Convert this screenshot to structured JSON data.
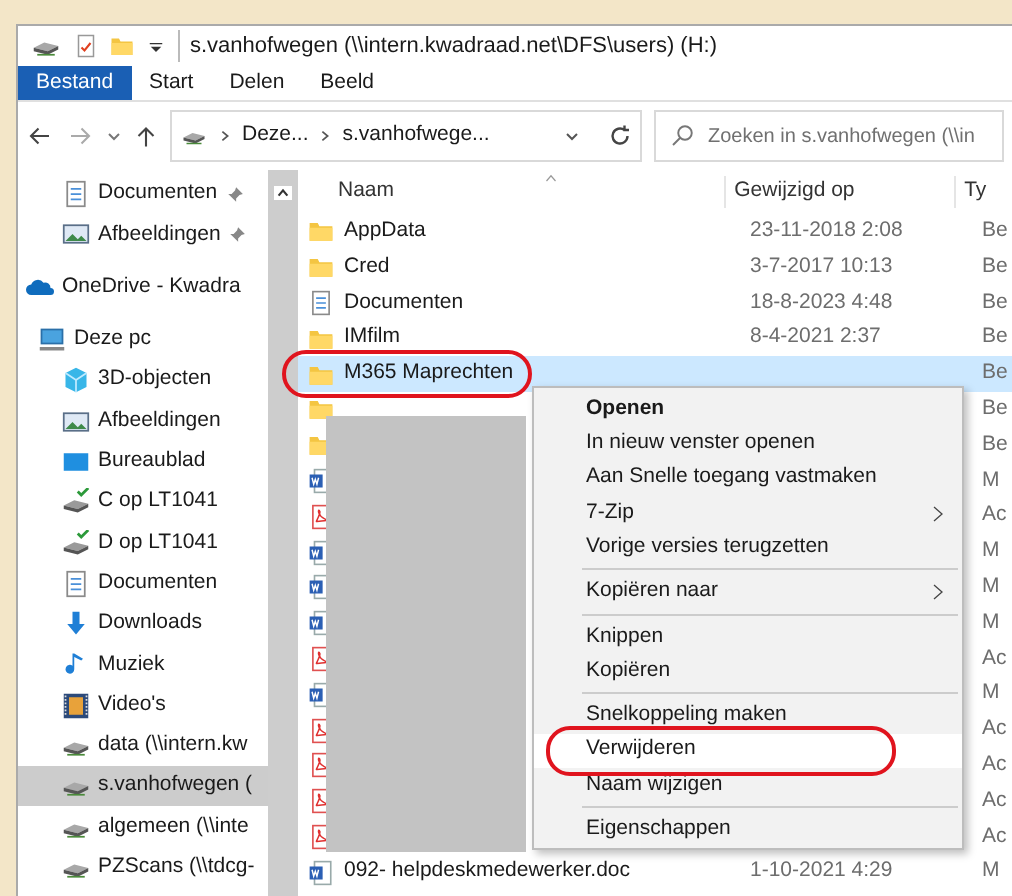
{
  "window": {
    "title": "s.vanhofwegen (\\\\intern.kwadraad.net\\DFS\\users) (H:)"
  },
  "ribbon_tabs": [
    {
      "label": "Bestand",
      "selected": true
    },
    {
      "label": "Start",
      "selected": false
    },
    {
      "label": "Delen",
      "selected": false
    },
    {
      "label": "Beeld",
      "selected": false
    }
  ],
  "address_bar": {
    "crumbs": [
      "Deze...",
      "s.vanhofwege..."
    ]
  },
  "search": {
    "placeholder": "Zoeken in s.vanhofwegen (\\\\in"
  },
  "sidebar": {
    "items": [
      {
        "label": "Documenten",
        "kind": "document",
        "pinned": true,
        "selected": false
      },
      {
        "label": "Afbeeldingen",
        "kind": "pictures",
        "pinned": true,
        "selected": false
      },
      {
        "label": "OneDrive - Kwadra",
        "kind": "cloud",
        "pinned": false,
        "selected": false
      },
      {
        "label": "Deze pc",
        "kind": "pc",
        "pinned": false,
        "selected": false,
        "children": [
          {
            "label": "3D-objecten",
            "kind": "cube",
            "pinned": false,
            "selected": false
          },
          {
            "label": "Afbeeldingen",
            "kind": "pictures",
            "pinned": false,
            "selected": false
          },
          {
            "label": "Bureaublad",
            "kind": "desktop",
            "pinned": false,
            "selected": false
          },
          {
            "label": "C op LT1041",
            "kind": "drive",
            "pinned": false,
            "selected": false
          },
          {
            "label": "D op LT1041",
            "kind": "drive",
            "pinned": false,
            "selected": false
          },
          {
            "label": "Documenten",
            "kind": "document",
            "pinned": false,
            "selected": false
          },
          {
            "label": "Downloads",
            "kind": "download",
            "pinned": false,
            "selected": false
          },
          {
            "label": "Muziek",
            "kind": "music",
            "pinned": false,
            "selected": false
          },
          {
            "label": "Video's",
            "kind": "video",
            "pinned": false,
            "selected": false
          },
          {
            "label": "data (\\\\intern.kw",
            "kind": "network",
            "pinned": false,
            "selected": false
          },
          {
            "label": "s.vanhofwegen (",
            "kind": "network",
            "pinned": false,
            "selected": true
          },
          {
            "label": "algemeen (\\\\inte",
            "kind": "network",
            "pinned": false,
            "selected": false
          },
          {
            "label": "PZScans (\\\\tdcg-",
            "kind": "network",
            "pinned": false,
            "selected": false
          }
        ]
      }
    ]
  },
  "table": {
    "columns": [
      "Naam",
      "Gewijzigd op",
      "Ty"
    ],
    "rows": [
      {
        "kind": "folder",
        "name": "AppData",
        "modified": "23-11-2018 2:08",
        "type": "Be",
        "selected": false,
        "circled": false
      },
      {
        "kind": "folder",
        "name": "Cred",
        "modified": "3-7-2017 10:13",
        "type": "Be",
        "selected": false,
        "circled": false
      },
      {
        "kind": "document",
        "name": "Documenten",
        "modified": "18-8-2023 4:48",
        "type": "Be",
        "selected": false,
        "circled": false
      },
      {
        "kind": "folder",
        "name": "IMfilm",
        "modified": "8-4-2021 2:37",
        "type": "Be",
        "selected": false,
        "circled": false
      },
      {
        "kind": "folder",
        "name": "M365 Maprechten",
        "type": "Be",
        "selected": true,
        "circled": true
      },
      {
        "kind": "folder",
        "type": "Be",
        "selected": false,
        "circled": false
      },
      {
        "kind": "folder",
        "type": "Be",
        "selected": false,
        "circled": false
      },
      {
        "kind": "word",
        "type": "M",
        "selected": false,
        "circled": false
      },
      {
        "kind": "pdf",
        "type": "Ac",
        "selected": false,
        "circled": false
      },
      {
        "kind": "word",
        "type": "M",
        "selected": false,
        "circled": false
      },
      {
        "kind": "word",
        "type": "M",
        "selected": false,
        "circled": false
      },
      {
        "kind": "word",
        "type": "M",
        "selected": false,
        "circled": false
      },
      {
        "kind": "pdf",
        "type": "Ac",
        "selected": false,
        "circled": false
      },
      {
        "kind": "word",
        "type": "M",
        "selected": false,
        "circled": false
      },
      {
        "kind": "pdf",
        "type": "Ac",
        "selected": false,
        "circled": false
      },
      {
        "kind": "pdf",
        "type": "Ac",
        "selected": false,
        "circled": false
      },
      {
        "kind": "pdf",
        "type": "Ac",
        "selected": false,
        "circled": false
      },
      {
        "kind": "pdf",
        "type": "Ac",
        "selected": false,
        "circled": false
      },
      {
        "kind": "word",
        "name": "092- helpdeskmedewerker.doc",
        "modified": "1-10-2021 4:29",
        "type": "M",
        "selected": false,
        "circled": false
      }
    ]
  },
  "context_menu": {
    "items": [
      {
        "kind": "default",
        "label": "Openen",
        "highlighted": false,
        "circled": false
      },
      {
        "kind": "item",
        "label": "In nieuw venster openen",
        "highlighted": false,
        "circled": false
      },
      {
        "kind": "item",
        "label": "Aan Snelle toegang vastmaken",
        "highlighted": false,
        "circled": false
      },
      {
        "kind": "submenu",
        "label": "7-Zip",
        "highlighted": false,
        "circled": false
      },
      {
        "kind": "item",
        "label": "Vorige versies terugzetten",
        "highlighted": false,
        "circled": false
      },
      {
        "kind": "separator"
      },
      {
        "kind": "submenu",
        "label": "Kopiëren naar",
        "highlighted": false,
        "circled": false
      },
      {
        "kind": "separator"
      },
      {
        "kind": "item",
        "label": "Knippen",
        "highlighted": false,
        "circled": false
      },
      {
        "kind": "item",
        "label": "Kopiëren",
        "highlighted": false,
        "circled": false
      },
      {
        "kind": "separator"
      },
      {
        "kind": "item",
        "label": "Snelkoppeling maken",
        "highlighted": false,
        "circled": false
      },
      {
        "kind": "item",
        "label": "Verwijderen",
        "highlighted": true,
        "circled": true
      },
      {
        "kind": "item",
        "label": "Naam wijzigen",
        "highlighted": false,
        "circled": false
      },
      {
        "kind": "separator"
      },
      {
        "kind": "item",
        "label": "Eigenschappen",
        "highlighted": false,
        "circled": false
      }
    ]
  },
  "redacted_names": true
}
